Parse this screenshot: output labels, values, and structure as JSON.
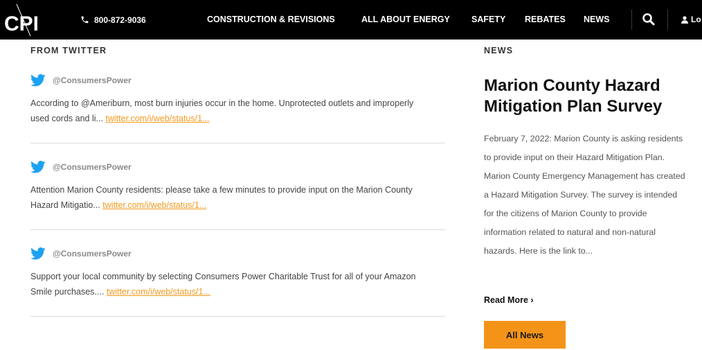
{
  "header": {
    "logo_text": "CPI",
    "phone": "800-872-9036",
    "nav": [
      {
        "label": "CONSTRUCTION & REVISIONS"
      },
      {
        "label": "ALL ABOUT ENERGY"
      },
      {
        "label": "SAFETY"
      },
      {
        "label": "REBATES"
      },
      {
        "label": "NEWS"
      }
    ],
    "login_label": "Lo"
  },
  "twitter": {
    "heading": "FROM TWITTER",
    "tweets": [
      {
        "handle": "@ConsumersPower",
        "text": "According to @Ameriburn, most burn injuries occur in the home. Unprotected outlets and improperly used cords and li...",
        "link": "twitter.com/i/web/status/1..."
      },
      {
        "handle": "@ConsumersPower",
        "text": "Attention Marion County residents: please take a few minutes to provide input on the Marion County Hazard Mitigatio...",
        "link": "twitter.com/i/web/status/1..."
      },
      {
        "handle": "@ConsumersPower",
        "text": "Support your local community by selecting Consumers Power Charitable Trust for all of your Amazon Smile purchases....",
        "link": "twitter.com/i/web/status/1..."
      }
    ]
  },
  "news": {
    "heading": "NEWS",
    "title": "Marion County Hazard Mitigation Plan Survey",
    "body": "February 7, 2022: Marion County is asking residents to provide input on their Hazard Mitigation Plan. Marion County Emergency Management has created a Hazard Mitigation Survey.  The survey is intended for the citizens of Marion County to provide information related to natural and non-natural hazards. Here is the link to...",
    "read_more": "Read More ›",
    "all_news": "All News"
  },
  "colors": {
    "accent": "#f39419",
    "link": "#f29a1e",
    "twitter": "#1da1f2",
    "topbar": "#000000"
  }
}
